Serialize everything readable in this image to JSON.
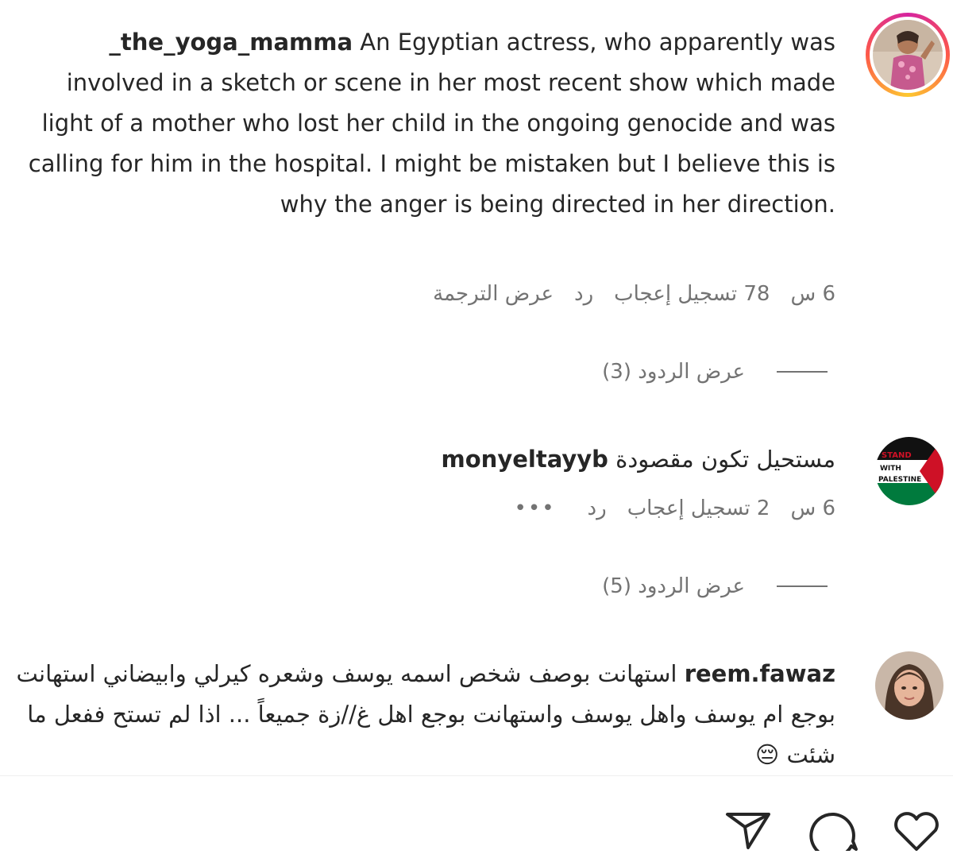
{
  "comments": [
    {
      "username": "_the_yoga_mamma",
      "text": "An Egyptian actress, who apparently was involved in a sketch or scene in her most recent show which made light of a mother who lost her child in the ongoing genocide and was calling for him in the hospital. I might be mistaken but I believe this is why the anger is being directed in her direction.",
      "time": "6 س",
      "likes": "78 تسجيل إعجاب",
      "reply_label": "رد",
      "translate_label": "عرض الترجمة",
      "view_replies": "عرض الردود (3)",
      "avatar_icon": "yoga-woman-avatar-icon",
      "story_ring": true
    },
    {
      "username": "monyeltayyb",
      "text": "مستحيل تكون مقصودة",
      "time": "6 س",
      "likes": "2 تسجيل إعجاب",
      "reply_label": "رد",
      "more_label": "•••",
      "view_replies": "عرض الردود (5)",
      "avatar_icon": "palestine-flag-avatar-icon",
      "avatar_text": "STAND WITH PALESTINE"
    },
    {
      "username": "reem.fawaz",
      "text": "استهانت بوصف شخص اسمه يوسف وشعره كيرلي وابيضاني استهانت بوجع ام يوسف واهل يوسف واستهانت بوجع اهل غ//زة جميعاً ... اذا لم تستح ففعل ما شئت 😔",
      "avatar_icon": "woman-portrait-avatar-icon"
    }
  ],
  "footer": {
    "icons": [
      "share-icon",
      "comment-icon",
      "like-icon"
    ]
  },
  "colors": {
    "text": "#262626",
    "secondary": "#737373",
    "flag_red": "#ce1126",
    "flag_green": "#007a3d"
  }
}
